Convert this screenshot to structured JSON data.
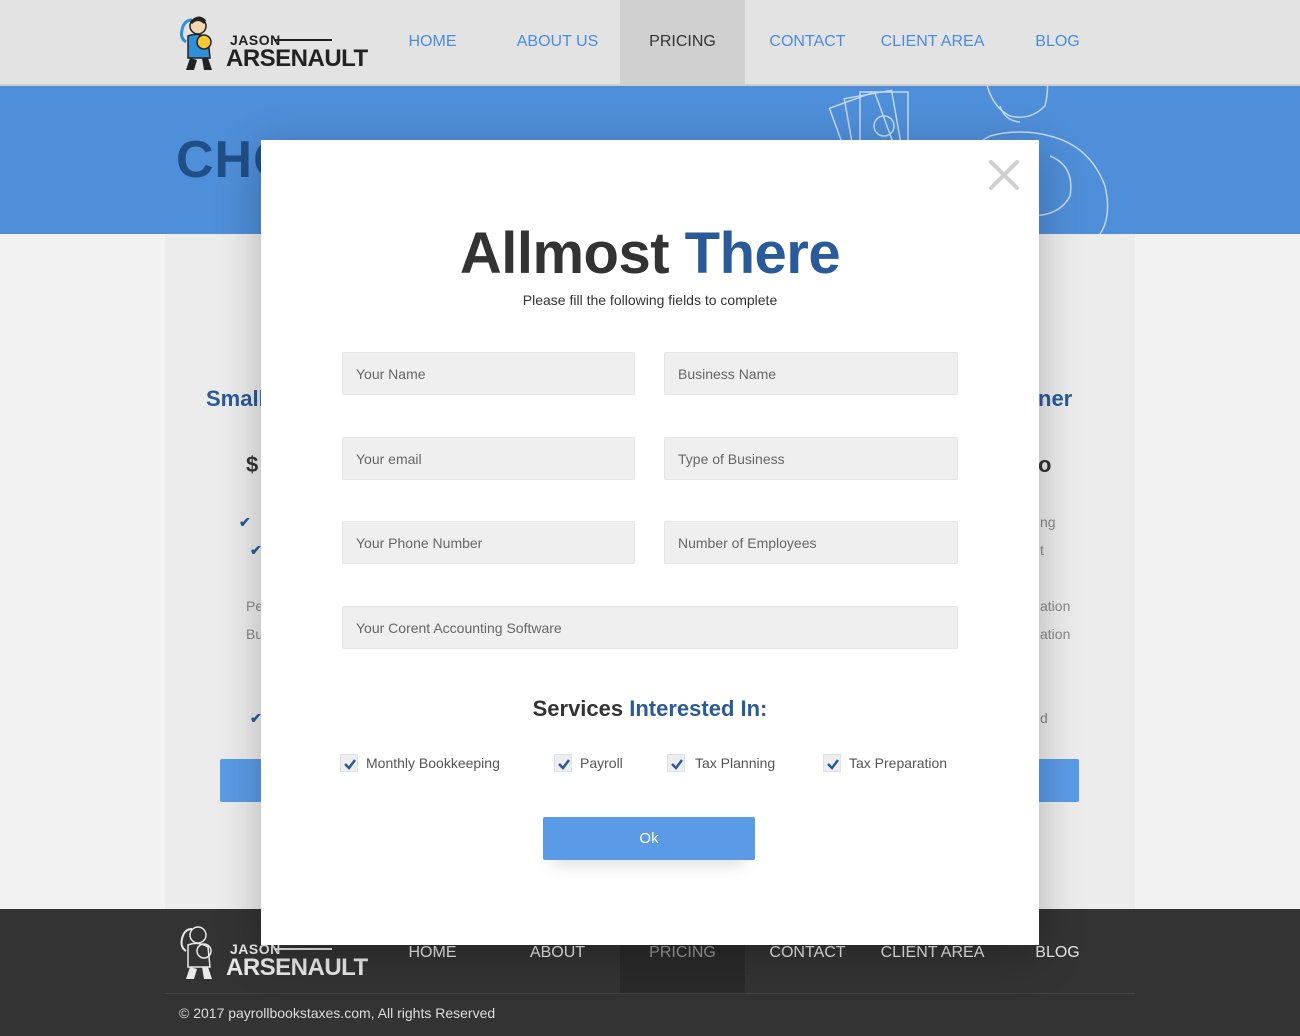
{
  "brand": {
    "logo_top": "JASON",
    "logo_bottom": "ARSENAULT"
  },
  "nav": {
    "items": [
      "HOME",
      "ABOUT US",
      "PRICING",
      "CONTACT",
      "CLIENT AREA",
      "BLOG"
    ],
    "active": "PRICING"
  },
  "hero": {
    "title_visible": "CHO"
  },
  "pricing_peek": {
    "left_title": "Small",
    "right_title": "ner",
    "left_price": "$",
    "right_price": "o",
    "left_items": [
      "Pe",
      "Bu"
    ],
    "right_items": [
      "ng",
      "t",
      "ation",
      "ation",
      "d"
    ]
  },
  "modal": {
    "title_main": "Allmost",
    "title_accent": "There",
    "subtitle": "Please fill the following fields to complete",
    "fields": {
      "your_name": "Your Name",
      "business_name": "Business Name",
      "your_email": "Your email",
      "type_of_business": "Type of Business",
      "phone_number": "Your Phone Number",
      "number_of_employees": "Number of Employees",
      "accounting_software": "Your Corent Accounting Software"
    },
    "services_title_main": "Services",
    "services_title_accent": "Interested In:",
    "services": [
      {
        "label": "Monthly Bookkeeping",
        "checked": true
      },
      {
        "label": "Payroll",
        "checked": true
      },
      {
        "label": "Tax Planning",
        "checked": true
      },
      {
        "label": "Tax Preparation",
        "checked": true
      }
    ],
    "ok_label": "Ok",
    "close_icon": "close-icon"
  },
  "footer": {
    "nav": [
      "HOME",
      "ABOUT",
      "PRICING",
      "CONTACT",
      "CLIENT AREA",
      "BLOG"
    ],
    "active": "PRICING",
    "copyright": "© 2017 payrollbookstaxes.com, All rights Reserved"
  },
  "colors": {
    "accent_blue": "#4a8de0",
    "dark_blue": "#2a5a98",
    "hero_blue": "#4f8ed8",
    "button_blue": "#5b9be6",
    "footer_bg": "#333333"
  }
}
